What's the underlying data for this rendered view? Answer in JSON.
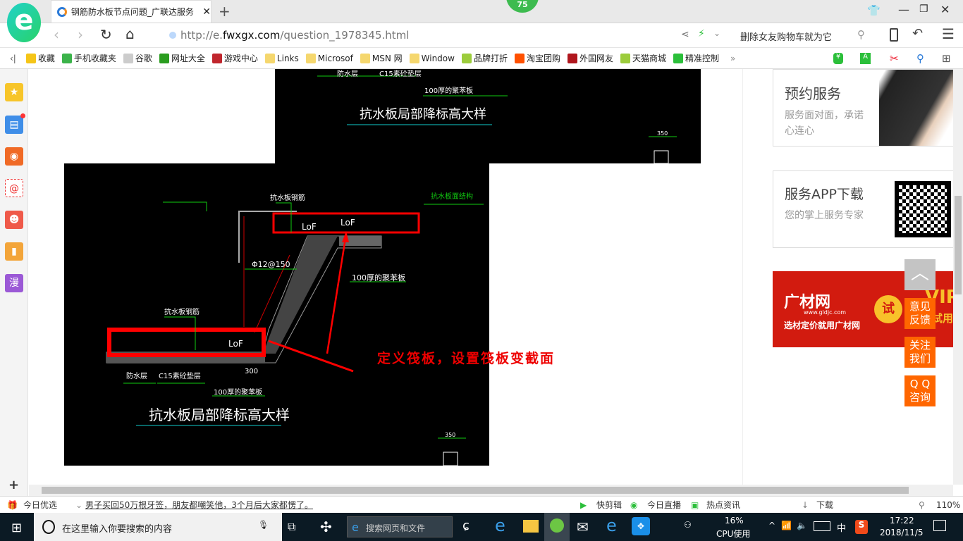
{
  "browser": {
    "badge": "75",
    "tab_title": "钢筋防水板节点问题_广联达服务",
    "url_prefix": "http://e.",
    "url_domain": "fwxgx.com",
    "url_path": "/question_1978345.html",
    "search_hint": "删除女友购物车就为它"
  },
  "bookmarks": [
    {
      "label": "收藏",
      "icon": "star-icon",
      "color": "#f5c518"
    },
    {
      "label": "手机收藏夹",
      "icon": "phone-icon",
      "color": "#3bb34a"
    },
    {
      "label": "谷歌",
      "icon": "page-icon",
      "color": "#ccc"
    },
    {
      "label": "网址大全",
      "icon": "plus-circle-icon",
      "color": "#2a9d1f"
    },
    {
      "label": "游戏中心",
      "icon": "game-icon",
      "color": "#c0262d"
    },
    {
      "label": "Links",
      "icon": "folder-icon",
      "color": "#f5d76e"
    },
    {
      "label": "Microsof",
      "icon": "folder-icon",
      "color": "#f5d76e"
    },
    {
      "label": "MSN 网",
      "icon": "folder-icon",
      "color": "#f5d76e"
    },
    {
      "label": "Window",
      "icon": "folder-icon",
      "color": "#f5d76e"
    },
    {
      "label": "品牌打折",
      "icon": "leaf-icon",
      "color": "#9ccc3c"
    },
    {
      "label": "淘宝团购",
      "icon": "taobao-icon",
      "color": "#ff5000"
    },
    {
      "label": "外国网友",
      "icon": "bookmark-icon",
      "color": "#b0161d"
    },
    {
      "label": "天猫商城",
      "icon": "leaf-icon",
      "color": "#9ccc3c"
    },
    {
      "label": "精准控制",
      "icon": "chat-icon",
      "color": "#2bbf3a"
    }
  ],
  "drawing": {
    "title": "抗水板局部降标高大样",
    "labels": {
      "rebar": "抗水板钢筋",
      "structure": "抗水板面结构",
      "phi": "Φ12@150",
      "foam": "100厚的聚苯板",
      "waterproof": "防水层",
      "c15": "C15素砼垫层",
      "lof": "LoF",
      "dim300": "300",
      "dim100": "100",
      "dim350": "350"
    },
    "annotation": "定义筏板，设置筏板变截面"
  },
  "right_panel": {
    "service": {
      "title": "预约服务",
      "desc": "服务面对面，承诺心连心"
    },
    "app": {
      "title": "服务APP下载",
      "desc": "您的掌上服务专家"
    },
    "ad": {
      "brand": "广材网",
      "url": "www.gldjc.com",
      "slogan": "选材定价就用广材网",
      "try": "试",
      "vip": "VIP",
      "vip_sub": "试用"
    },
    "float_buttons": [
      "意见反馈",
      "关注我们",
      "Q Q咨询"
    ]
  },
  "statusbar": {
    "today": "今日优选",
    "news": "男子买回50万根牙签，朋友都嘲笑他，3个月后大家都愣了。",
    "items": [
      "快剪辑",
      "今日直播",
      "热点资讯",
      "下载"
    ],
    "zoom": "110%"
  },
  "taskbar": {
    "search_placeholder": "在这里输入你要搜索的内容",
    "web_search": "搜索网页和文件",
    "cpu_percent": "16%",
    "cpu_label": "CPU使用",
    "ime": "中",
    "time": "17:22",
    "date": "2018/11/5"
  }
}
